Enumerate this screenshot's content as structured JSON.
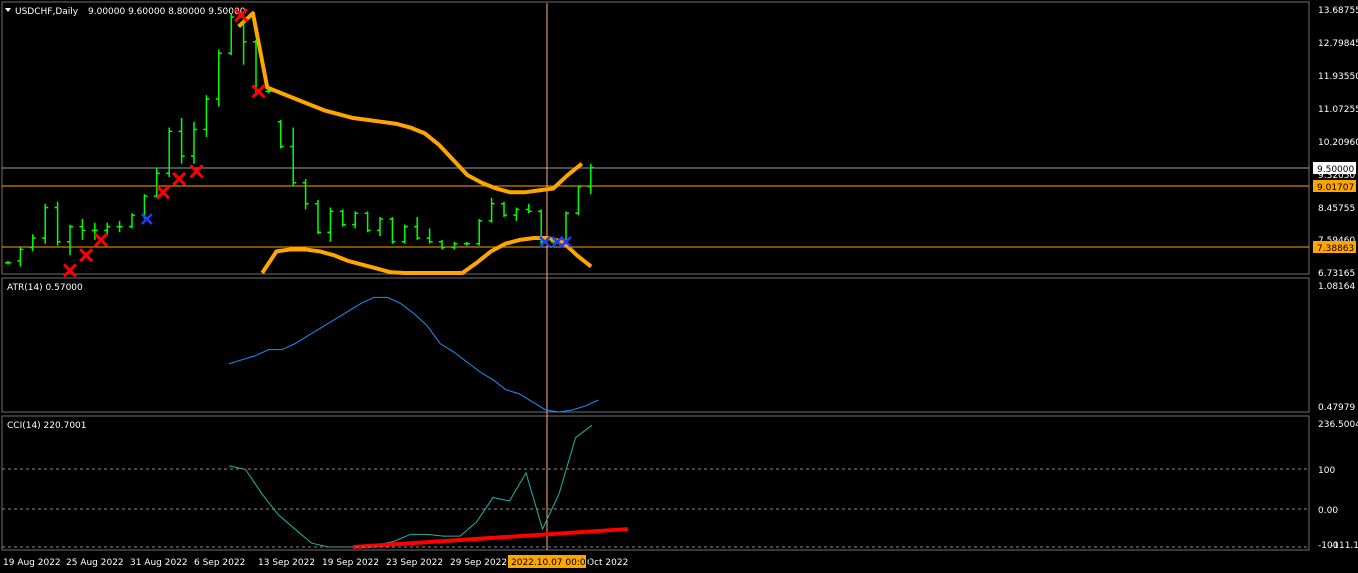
{
  "chart": {
    "symbol": "USDCHF,Daily",
    "ohlc_text": "9.00000 9.60000 8.80000 9.50000",
    "colors": {
      "bg": "#000000",
      "bars": "#00ff00",
      "envelope": "#ffa500",
      "atr": "#1e90ff",
      "cci": "#20b2aa",
      "marker_red": "#ff0000",
      "marker_blue": "#1e3cff",
      "hline": "#ffa500",
      "crosshair": "#ffb07a",
      "trendline": "#ff0000"
    },
    "price_axis": [
      "13.68755",
      "12.79845",
      "11.93550",
      "11.07255",
      "10.20960",
      "9.32050",
      "8.45755",
      "7.59460",
      "6.73165"
    ],
    "price_tags": {
      "current": "9.50000",
      "level_1": "9.01707",
      "level_2": "7.38863"
    },
    "date_axis": [
      "19 Aug 2022",
      "25 Aug 2022",
      "31 Aug 2022",
      "6 Sep 2022",
      "13 Sep 2022",
      "19 Sep 2022",
      "23 Sep 2022",
      "29 Sep 2022",
      "Oct 2022"
    ],
    "crosshair_date": "2022.10.07 00:00"
  },
  "atr": {
    "title": "ATR(14) 0.57000",
    "axis": [
      "1.08164",
      "0.47979"
    ]
  },
  "cci": {
    "title": "CCI(14) 220.7001",
    "axis": [
      "236.5004",
      "100",
      "0.00",
      "-100",
      "-111.1068"
    ]
  },
  "chart_data": [
    {
      "type": "bar",
      "title": "USDCHF,Daily",
      "ohlc": [
        {
          "o": 7.0,
          "h": 7.05,
          "l": 6.95,
          "c": 7.0
        },
        {
          "o": 7.05,
          "h": 7.4,
          "l": 6.9,
          "c": 7.35
        },
        {
          "o": 7.4,
          "h": 7.75,
          "l": 7.3,
          "c": 7.65
        },
        {
          "o": 7.65,
          "h": 8.55,
          "l": 7.5,
          "c": 8.45
        },
        {
          "o": 8.45,
          "h": 8.6,
          "l": 7.45,
          "c": 7.55
        },
        {
          "o": 7.55,
          "h": 8.0,
          "l": 7.2,
          "c": 7.95
        },
        {
          "o": 7.95,
          "h": 8.15,
          "l": 7.6,
          "c": 7.85
        },
        {
          "o": 7.85,
          "h": 8.05,
          "l": 7.6,
          "c": 7.85
        },
        {
          "o": 7.85,
          "h": 8.05,
          "l": 7.75,
          "c": 7.95
        },
        {
          "o": 7.95,
          "h": 8.1,
          "l": 7.8,
          "c": 7.95
        },
        {
          "o": 7.95,
          "h": 8.3,
          "l": 7.9,
          "c": 8.25
        },
        {
          "o": 8.25,
          "h": 8.8,
          "l": 8.15,
          "c": 8.75
        },
        {
          "o": 8.75,
          "h": 9.5,
          "l": 8.7,
          "c": 9.35
        },
        {
          "o": 9.35,
          "h": 10.55,
          "l": 9.25,
          "c": 10.45
        },
        {
          "o": 10.45,
          "h": 10.8,
          "l": 9.6,
          "c": 9.8
        },
        {
          "o": 9.8,
          "h": 10.7,
          "l": 9.6,
          "c": 10.5
        },
        {
          "o": 10.5,
          "h": 11.4,
          "l": 10.3,
          "c": 11.3
        },
        {
          "o": 11.3,
          "h": 12.6,
          "l": 11.1,
          "c": 12.5
        },
        {
          "o": 12.5,
          "h": 13.55,
          "l": 12.45,
          "c": 13.45
        },
        {
          "o": 13.45,
          "h": 13.5,
          "l": 12.2,
          "c": 12.8
        },
        {
          "o": 12.8,
          "h": 12.85,
          "l": 11.4,
          "c": 11.5
        },
        {
          "o": 11.5,
          "h": 11.55,
          "l": 11.45,
          "c": 11.5
        },
        {
          "o": 10.7,
          "h": 10.75,
          "l": 10.0,
          "c": 10.05
        },
        {
          "o": 10.05,
          "h": 10.55,
          "l": 9.0,
          "c": 9.1
        },
        {
          "o": 9.1,
          "h": 9.2,
          "l": 8.4,
          "c": 8.55
        },
        {
          "o": 8.55,
          "h": 8.65,
          "l": 7.75,
          "c": 7.8
        },
        {
          "o": 7.8,
          "h": 8.45,
          "l": 7.55,
          "c": 8.35
        },
        {
          "o": 8.35,
          "h": 8.4,
          "l": 7.95,
          "c": 8.0
        },
        {
          "o": 8.0,
          "h": 8.35,
          "l": 7.9,
          "c": 8.3
        },
        {
          "o": 8.3,
          "h": 8.35,
          "l": 7.8,
          "c": 7.85
        },
        {
          "o": 7.85,
          "h": 8.2,
          "l": 7.7,
          "c": 8.15
        },
        {
          "o": 8.15,
          "h": 8.2,
          "l": 7.5,
          "c": 7.55
        },
        {
          "o": 7.55,
          "h": 8.0,
          "l": 7.5,
          "c": 7.95
        },
        {
          "o": 7.95,
          "h": 8.2,
          "l": 7.6,
          "c": 7.65
        },
        {
          "o": 7.65,
          "h": 7.9,
          "l": 7.5,
          "c": 7.55
        },
        {
          "o": 7.55,
          "h": 7.6,
          "l": 7.35,
          "c": 7.4
        },
        {
          "o": 7.4,
          "h": 7.55,
          "l": 7.35,
          "c": 7.5
        },
        {
          "o": 7.5,
          "h": 7.55,
          "l": 7.45,
          "c": 7.5
        },
        {
          "o": 7.5,
          "h": 8.15,
          "l": 7.45,
          "c": 8.1
        },
        {
          "o": 8.1,
          "h": 8.7,
          "l": 8.05,
          "c": 8.55
        },
        {
          "o": 8.55,
          "h": 8.6,
          "l": 8.2,
          "c": 8.25
        },
        {
          "o": 8.25,
          "h": 8.45,
          "l": 8.1,
          "c": 8.4
        },
        {
          "o": 8.4,
          "h": 8.55,
          "l": 8.3,
          "c": 8.35
        },
        {
          "o": 8.35,
          "h": 8.4,
          "l": 7.45,
          "c": 7.55
        },
        {
          "o": 7.55,
          "h": 7.65,
          "l": 7.5,
          "c": 7.6
        },
        {
          "o": 7.6,
          "h": 8.35,
          "l": 7.5,
          "c": 8.3
        },
        {
          "o": 8.3,
          "h": 9.0,
          "l": 8.25,
          "c": 9.0
        },
        {
          "o": 9.0,
          "h": 9.6,
          "l": 8.8,
          "c": 9.5
        }
      ],
      "envelope_upper": [
        13.2,
        13.55,
        11.6,
        11.45,
        11.3,
        11.15,
        11.0,
        10.9,
        10.8,
        10.75,
        10.7,
        10.65,
        10.55,
        10.4,
        10.1,
        9.7,
        9.3,
        9.1,
        8.95,
        8.85,
        8.85,
        8.9,
        8.95,
        9.3,
        9.6
      ],
      "envelope_lower": [
        6.73,
        7.3,
        7.35,
        7.35,
        7.3,
        7.2,
        7.05,
        6.95,
        6.85,
        6.75,
        6.73,
        6.73,
        6.73,
        6.73,
        6.73,
        7.0,
        7.3,
        7.5,
        7.6,
        7.65,
        7.65,
        7.55,
        7.2,
        6.9
      ],
      "red_markers": [
        6.8,
        7.2,
        7.6,
        8.85,
        9.2,
        9.4,
        13.5,
        11.5
      ],
      "blue_markers": [
        8.15,
        7.55,
        7.55,
        7.55
      ],
      "ylim": [
        6.73165,
        13.68755
      ]
    },
    {
      "type": "line",
      "title": "ATR(14) 0.57000",
      "series": [
        {
          "name": "ATR(14)",
          "values": [
            0.7,
            0.72,
            0.74,
            0.77,
            0.77,
            0.8,
            0.84,
            0.88,
            0.92,
            0.96,
            1.0,
            1.03,
            1.03,
            1.0,
            0.95,
            0.89,
            0.8,
            0.76,
            0.71,
            0.66,
            0.62,
            0.57,
            0.55,
            0.51,
            0.47,
            0.46,
            0.47,
            0.49,
            0.52
          ]
        }
      ],
      "ylim": [
        0.47979,
        1.08164
      ]
    },
    {
      "type": "line",
      "title": "CCI(14) 220.7001",
      "series": [
        {
          "name": "CCI(14)",
          "values": [
            120,
            110,
            40,
            -20,
            -60,
            -100,
            -111,
            -111,
            -111,
            -105,
            -95,
            -75,
            -75,
            -80,
            -80,
            -40,
            30,
            20,
            100,
            -60,
            40,
            200,
            236
          ]
        }
      ],
      "trendline": [
        -111,
        -60
      ],
      "levels": [
        100,
        0,
        -100
      ],
      "ylim": [
        -111.1068,
        236.5004
      ]
    }
  ]
}
